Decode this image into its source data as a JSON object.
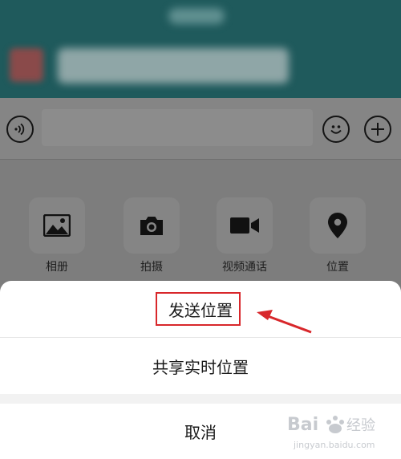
{
  "panel": {
    "items": [
      {
        "label": "相册",
        "icon": "photo-album-icon"
      },
      {
        "label": "拍摄",
        "icon": "camera-icon"
      },
      {
        "label": "视频通话",
        "icon": "video-call-icon"
      },
      {
        "label": "位置",
        "icon": "location-pin-icon"
      }
    ]
  },
  "sheet": {
    "send_location": "发送位置",
    "share_live_location": "共享实时位置",
    "cancel": "取消"
  },
  "annotation": {
    "highlight_color": "#d8272b"
  },
  "watermark": {
    "brand": "Baidu 经验",
    "url": "jingyan.baidu.com"
  }
}
